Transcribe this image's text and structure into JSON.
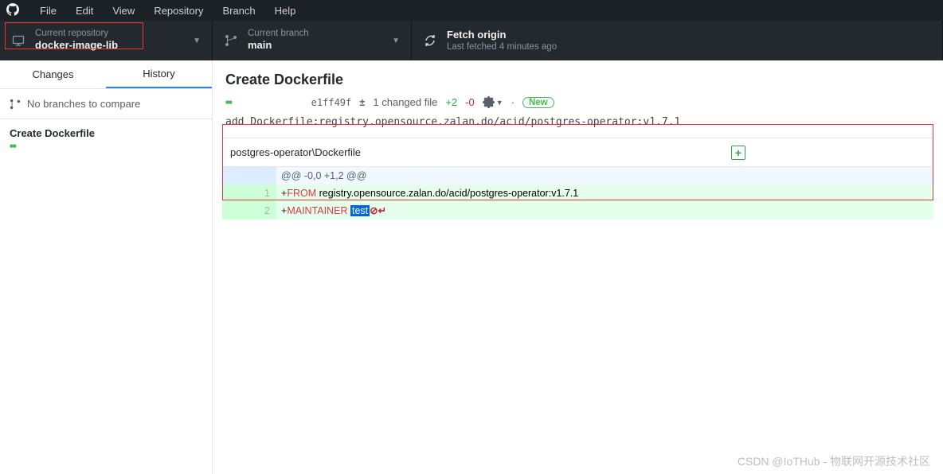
{
  "menu": {
    "items": [
      "File",
      "Edit",
      "View",
      "Repository",
      "Branch",
      "Help"
    ]
  },
  "header": {
    "repo": {
      "label": "Current repository",
      "value": "docker-image-lib"
    },
    "branch": {
      "label": "Current branch",
      "value": "main"
    },
    "fetch": {
      "label": "Fetch origin",
      "value": "Last fetched 4 minutes ago"
    }
  },
  "sidebar": {
    "tabs": {
      "changes": "Changes",
      "history": "History"
    },
    "compare_text": "No branches to compare",
    "commit_item": "Create Dockerfile"
  },
  "commit": {
    "title": "Create Dockerfile",
    "sha": "e1ff49f",
    "diffstat_icon": "±",
    "changed_files": "1 changed file",
    "additions": "+2",
    "deletions": "-0",
    "new_badge": "New",
    "message": "add Dockerfile:registry.opensource.zalan.do/acid/postgres-operator:v1.7.1"
  },
  "diff": {
    "file_path": "postgres-operator\\Dockerfile",
    "hunk": "@@ -0,0 +1,2 @@",
    "lines": [
      {
        "n": "1",
        "prefix": "+",
        "kw": "FROM",
        "rest": " registry.opensource.zalan.do/acid/postgres-operator:v1.7.1"
      },
      {
        "n": "2",
        "prefix": "+",
        "kw": "MAINTAINER",
        "sel": "test",
        "trail": "⊘↵"
      }
    ]
  },
  "watermark": "CSDN @IoTHub - 物联网开源技术社区"
}
